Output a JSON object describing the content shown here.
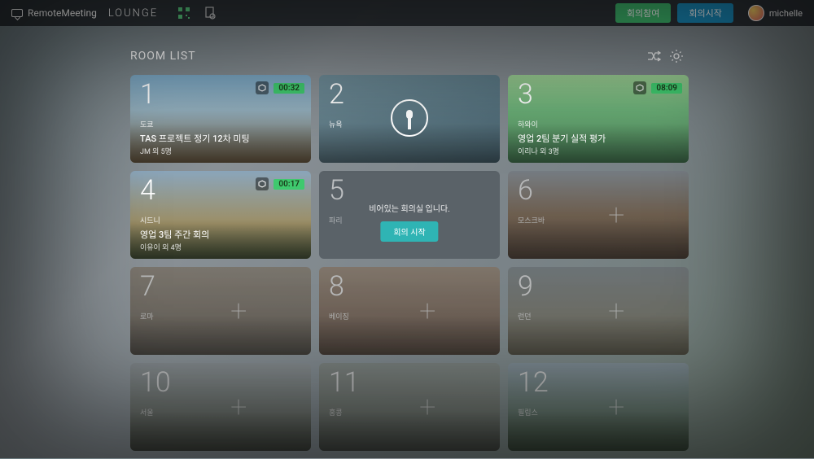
{
  "brand": {
    "name": "RemoteMeeting",
    "section": "LOUNGE"
  },
  "topbar": {
    "join": "회의참여",
    "start": "회의시작"
  },
  "user": {
    "name": "michelle"
  },
  "page": {
    "title": "ROOM LIST"
  },
  "rooms": [
    {
      "num": "1",
      "city": "도쿄",
      "title": "TAS 프로젝트 정기 12차 미팅",
      "sub": "JM 외 5명",
      "timer": "00:32"
    },
    {
      "num": "2",
      "city": "뉴욕"
    },
    {
      "num": "3",
      "city": "하와이",
      "title": "영업 2팀 분기 실적 평가",
      "sub": "이리나 외 3명",
      "timer": "08:09"
    },
    {
      "num": "4",
      "city": "시드니",
      "title": "영업 3팀 주간 회의",
      "sub": "이유이 외 4명",
      "timer": "00:17"
    },
    {
      "num": "5",
      "city": "파리",
      "empty_msg": "비어있는 회의실 입니다.",
      "empty_btn": "회의 시작"
    },
    {
      "num": "6",
      "city": "모스크바"
    },
    {
      "num": "7",
      "city": "로마"
    },
    {
      "num": "8",
      "city": "베이징"
    },
    {
      "num": "9",
      "city": "런던"
    },
    {
      "num": "10",
      "city": "서울"
    },
    {
      "num": "11",
      "city": "홍콩"
    },
    {
      "num": "12",
      "city": "필립스"
    }
  ]
}
